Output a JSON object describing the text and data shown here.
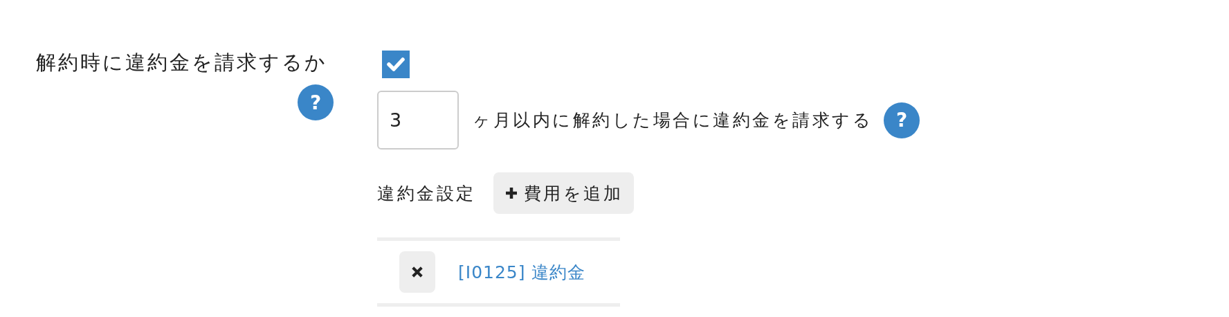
{
  "field": {
    "label": "解約時に違約金を請求するか",
    "help": "?"
  },
  "charge_penalty": {
    "checked": true
  },
  "months": {
    "value": "3",
    "suffix": "ヶ月以内に解約した場合に違約金を請求する",
    "help": "?"
  },
  "penalty_settings": {
    "label": "違約金設定",
    "add_button": "費用を追加"
  },
  "fees": [
    {
      "name": "[I0125] 違約金"
    }
  ]
}
